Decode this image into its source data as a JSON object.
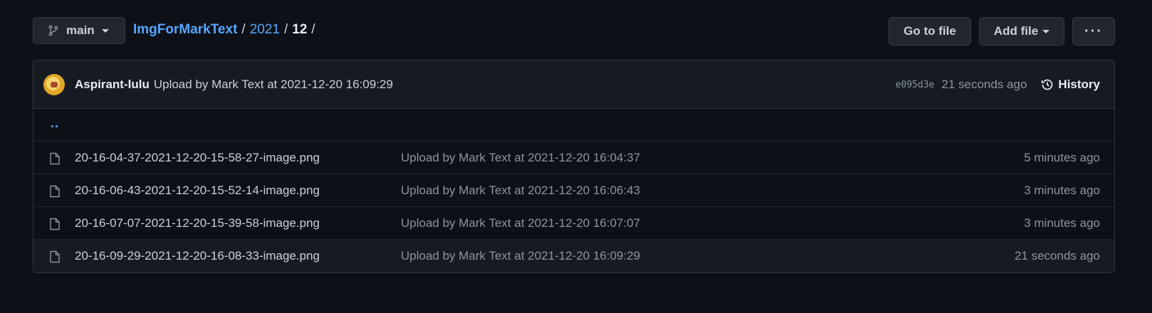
{
  "branch": {
    "name": "main"
  },
  "breadcrumb": {
    "repo": "ImgForMarkText",
    "folder": "2021",
    "current": "12",
    "sep1": "/",
    "sep2": "/",
    "sep3": "/"
  },
  "actions": {
    "go_to_file": "Go to file",
    "add_file": "Add file",
    "more": "···"
  },
  "latest_commit": {
    "author": "Aspirant-lulu",
    "message": "Upload by Mark Text at 2021-12-20 16:09:29",
    "sha": "e095d3e",
    "time": "21 seconds ago",
    "history_label": "History"
  },
  "parent_link": "..",
  "files": [
    {
      "name": "20-16-04-37-2021-12-20-15-58-27-image.png",
      "message": "Upload by Mark Text at 2021-12-20 16:04:37",
      "age": "5 minutes ago"
    },
    {
      "name": "20-16-06-43-2021-12-20-15-52-14-image.png",
      "message": "Upload by Mark Text at 2021-12-20 16:06:43",
      "age": "3 minutes ago"
    },
    {
      "name": "20-16-07-07-2021-12-20-15-39-58-image.png",
      "message": "Upload by Mark Text at 2021-12-20 16:07:07",
      "age": "3 minutes ago"
    },
    {
      "name": "20-16-09-29-2021-12-20-16-08-33-image.png",
      "message": "Upload by Mark Text at 2021-12-20 16:09:29",
      "age": "21 seconds ago"
    }
  ],
  "colors": {
    "background": "#0d1117",
    "link": "#58a6ff",
    "muted": "#8b949e",
    "border": "#30363d"
  }
}
